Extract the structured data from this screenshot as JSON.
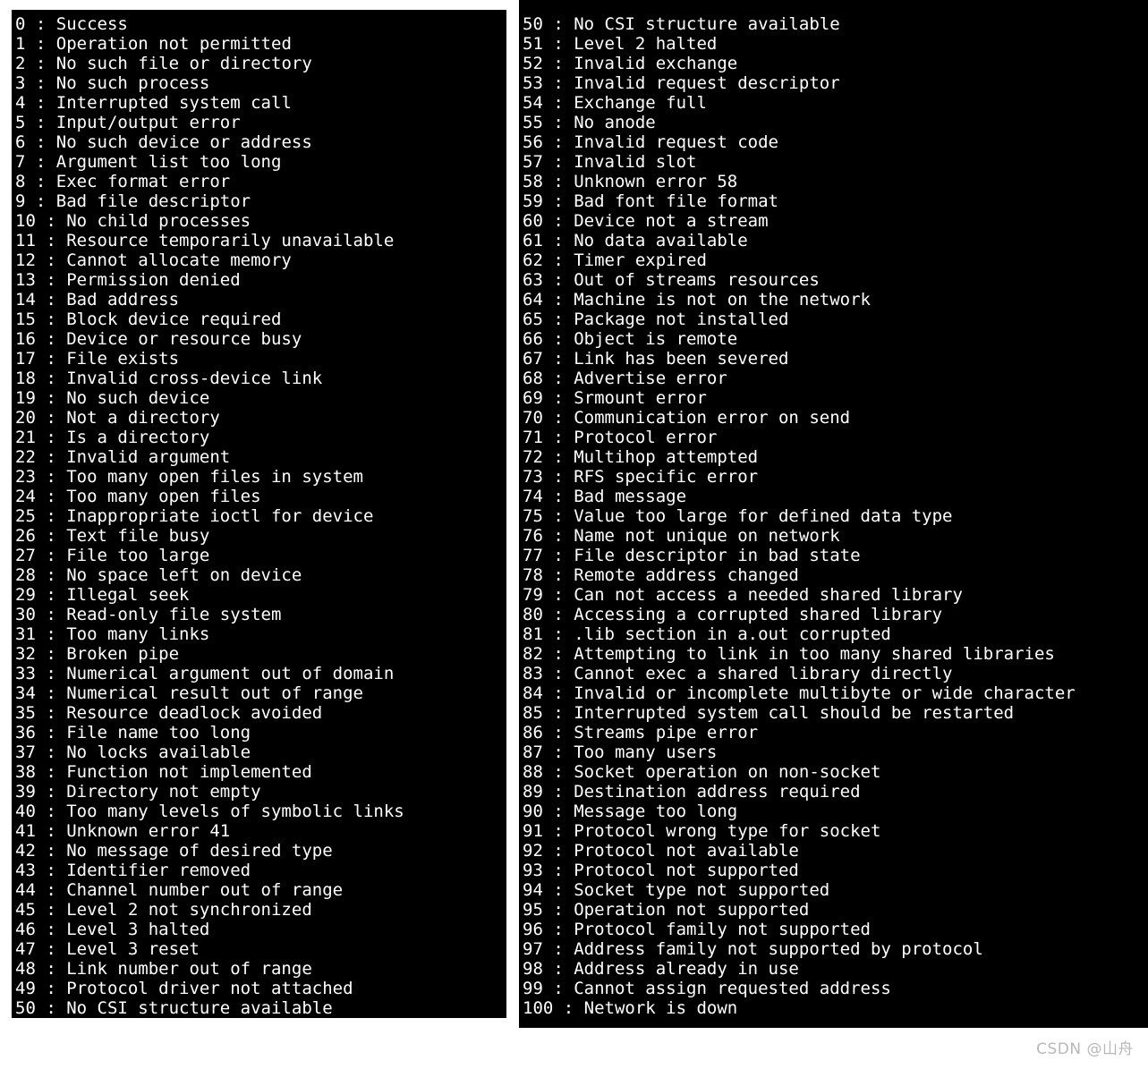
{
  "page": {
    "background_color": "#ffffff",
    "terminal_background": "#000000",
    "terminal_foreground": "#ffffff",
    "separator": " : "
  },
  "watermark": {
    "text": "CSDN @山舟",
    "color": "#b8b8b8"
  },
  "panels": [
    {
      "name": "left-column",
      "lines": [
        {
          "code": "0",
          "message": "Success"
        },
        {
          "code": "1",
          "message": "Operation not permitted"
        },
        {
          "code": "2",
          "message": "No such file or directory"
        },
        {
          "code": "3",
          "message": "No such process"
        },
        {
          "code": "4",
          "message": "Interrupted system call"
        },
        {
          "code": "5",
          "message": "Input/output error"
        },
        {
          "code": "6",
          "message": "No such device or address"
        },
        {
          "code": "7",
          "message": "Argument list too long"
        },
        {
          "code": "8",
          "message": "Exec format error"
        },
        {
          "code": "9",
          "message": "Bad file descriptor"
        },
        {
          "code": "10",
          "message": "No child processes"
        },
        {
          "code": "11",
          "message": "Resource temporarily unavailable"
        },
        {
          "code": "12",
          "message": "Cannot allocate memory"
        },
        {
          "code": "13",
          "message": "Permission denied"
        },
        {
          "code": "14",
          "message": "Bad address"
        },
        {
          "code": "15",
          "message": "Block device required"
        },
        {
          "code": "16",
          "message": "Device or resource busy"
        },
        {
          "code": "17",
          "message": "File exists"
        },
        {
          "code": "18",
          "message": "Invalid cross-device link"
        },
        {
          "code": "19",
          "message": "No such device"
        },
        {
          "code": "20",
          "message": "Not a directory"
        },
        {
          "code": "21",
          "message": "Is a directory"
        },
        {
          "code": "22",
          "message": "Invalid argument"
        },
        {
          "code": "23",
          "message": "Too many open files in system"
        },
        {
          "code": "24",
          "message": "Too many open files"
        },
        {
          "code": "25",
          "message": "Inappropriate ioctl for device"
        },
        {
          "code": "26",
          "message": "Text file busy"
        },
        {
          "code": "27",
          "message": "File too large"
        },
        {
          "code": "28",
          "message": "No space left on device"
        },
        {
          "code": "29",
          "message": "Illegal seek"
        },
        {
          "code": "30",
          "message": "Read-only file system"
        },
        {
          "code": "31",
          "message": "Too many links"
        },
        {
          "code": "32",
          "message": "Broken pipe"
        },
        {
          "code": "33",
          "message": "Numerical argument out of domain"
        },
        {
          "code": "34",
          "message": "Numerical result out of range"
        },
        {
          "code": "35",
          "message": "Resource deadlock avoided"
        },
        {
          "code": "36",
          "message": "File name too long"
        },
        {
          "code": "37",
          "message": "No locks available"
        },
        {
          "code": "38",
          "message": "Function not implemented"
        },
        {
          "code": "39",
          "message": "Directory not empty"
        },
        {
          "code": "40",
          "message": "Too many levels of symbolic links"
        },
        {
          "code": "41",
          "message": "Unknown error 41"
        },
        {
          "code": "42",
          "message": "No message of desired type"
        },
        {
          "code": "43",
          "message": "Identifier removed"
        },
        {
          "code": "44",
          "message": "Channel number out of range"
        },
        {
          "code": "45",
          "message": "Level 2 not synchronized"
        },
        {
          "code": "46",
          "message": "Level 3 halted"
        },
        {
          "code": "47",
          "message": "Level 3 reset"
        },
        {
          "code": "48",
          "message": "Link number out of range"
        },
        {
          "code": "49",
          "message": "Protocol driver not attached"
        },
        {
          "code": "50",
          "message": "No CSI structure available"
        }
      ]
    },
    {
      "name": "right-column",
      "lines": [
        {
          "code": "50",
          "message": "No CSI structure available"
        },
        {
          "code": "51",
          "message": "Level 2 halted"
        },
        {
          "code": "52",
          "message": "Invalid exchange"
        },
        {
          "code": "53",
          "message": "Invalid request descriptor"
        },
        {
          "code": "54",
          "message": "Exchange full"
        },
        {
          "code": "55",
          "message": "No anode"
        },
        {
          "code": "56",
          "message": "Invalid request code"
        },
        {
          "code": "57",
          "message": "Invalid slot"
        },
        {
          "code": "58",
          "message": "Unknown error 58"
        },
        {
          "code": "59",
          "message": "Bad font file format"
        },
        {
          "code": "60",
          "message": "Device not a stream"
        },
        {
          "code": "61",
          "message": "No data available"
        },
        {
          "code": "62",
          "message": "Timer expired"
        },
        {
          "code": "63",
          "message": "Out of streams resources"
        },
        {
          "code": "64",
          "message": "Machine is not on the network"
        },
        {
          "code": "65",
          "message": "Package not installed"
        },
        {
          "code": "66",
          "message": "Object is remote"
        },
        {
          "code": "67",
          "message": "Link has been severed"
        },
        {
          "code": "68",
          "message": "Advertise error"
        },
        {
          "code": "69",
          "message": "Srmount error"
        },
        {
          "code": "70",
          "message": "Communication error on send"
        },
        {
          "code": "71",
          "message": "Protocol error"
        },
        {
          "code": "72",
          "message": "Multihop attempted"
        },
        {
          "code": "73",
          "message": "RFS specific error"
        },
        {
          "code": "74",
          "message": "Bad message"
        },
        {
          "code": "75",
          "message": "Value too large for defined data type"
        },
        {
          "code": "76",
          "message": "Name not unique on network"
        },
        {
          "code": "77",
          "message": "File descriptor in bad state"
        },
        {
          "code": "78",
          "message": "Remote address changed"
        },
        {
          "code": "79",
          "message": "Can not access a needed shared library"
        },
        {
          "code": "80",
          "message": "Accessing a corrupted shared library"
        },
        {
          "code": "81",
          "message": ".lib section in a.out corrupted"
        },
        {
          "code": "82",
          "message": "Attempting to link in too many shared libraries"
        },
        {
          "code": "83",
          "message": "Cannot exec a shared library directly"
        },
        {
          "code": "84",
          "message": "Invalid or incomplete multibyte or wide character"
        },
        {
          "code": "85",
          "message": "Interrupted system call should be restarted"
        },
        {
          "code": "86",
          "message": "Streams pipe error"
        },
        {
          "code": "87",
          "message": "Too many users"
        },
        {
          "code": "88",
          "message": "Socket operation on non-socket"
        },
        {
          "code": "89",
          "message": "Destination address required"
        },
        {
          "code": "90",
          "message": "Message too long"
        },
        {
          "code": "91",
          "message": "Protocol wrong type for socket"
        },
        {
          "code": "92",
          "message": "Protocol not available"
        },
        {
          "code": "93",
          "message": "Protocol not supported"
        },
        {
          "code": "94",
          "message": "Socket type not supported"
        },
        {
          "code": "95",
          "message": "Operation not supported"
        },
        {
          "code": "96",
          "message": "Protocol family not supported"
        },
        {
          "code": "97",
          "message": "Address family not supported by protocol"
        },
        {
          "code": "98",
          "message": "Address already in use"
        },
        {
          "code": "99",
          "message": "Cannot assign requested address"
        },
        {
          "code": "100",
          "message": "Network is down"
        }
      ]
    }
  ]
}
